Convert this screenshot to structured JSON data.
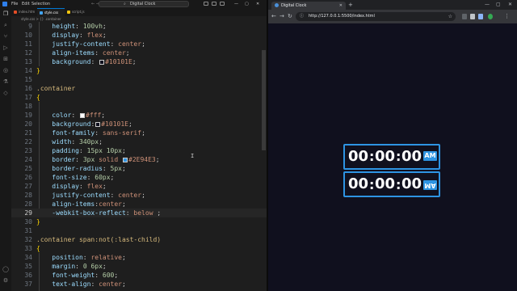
{
  "vscode": {
    "menu": [
      "File",
      "Edit",
      "Selection"
    ],
    "search_text": "Digital Clock",
    "tabs": [
      {
        "label": "index.htm",
        "color": "#e44d26"
      },
      {
        "label": "style.css",
        "color": "#42a5f5"
      },
      {
        "label": "script.js",
        "color": "#f1c40f"
      }
    ],
    "breadcrumb": "style.css > {} .container",
    "current_line": 29
  },
  "browser": {
    "tab_title": "Digital Clock",
    "url": "http://127.0.0.1:5500/index.html"
  },
  "clock": {
    "hours": "00",
    "minutes": "00",
    "seconds": "00",
    "separator": ":",
    "ampm": "AM",
    "border_color": "#2E94E3",
    "background": "#10101E",
    "text_color": "#fff"
  },
  "colors": {
    "white": "#fff",
    "dark": "#10101E",
    "blue": "#2E94E3"
  }
}
